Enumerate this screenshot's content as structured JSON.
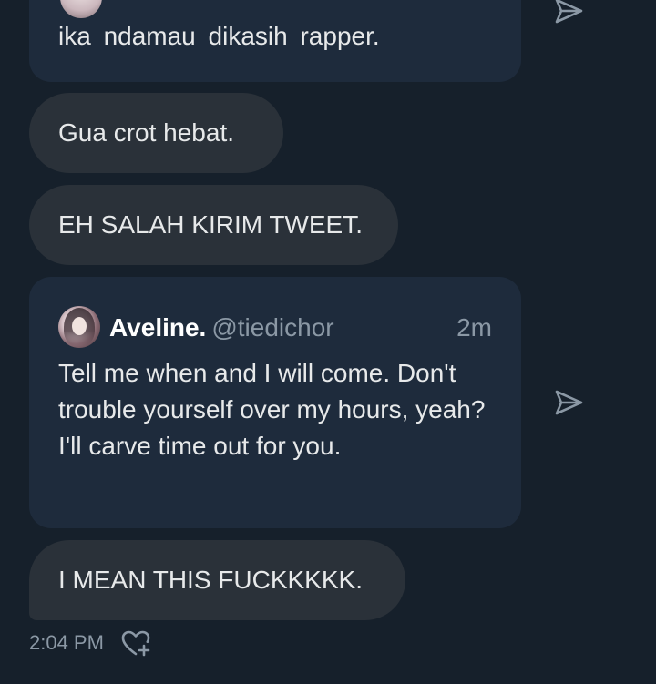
{
  "messages": {
    "quote_top": {
      "text": "ika  ndamau  dikasih  rapper."
    },
    "bubble_1": "Gua crot hebat.",
    "bubble_2": "EH SALAH KIRIM TWEET.",
    "quote_mid": {
      "name": "Aveline.",
      "handle": "@tiedichor",
      "time": "2m",
      "text": "Tell me when and I will come. Don't trouble yourself over my hours, yeah? I'll carve time out for you."
    },
    "bubble_3": "I MEAN THIS FUCKKKKK."
  },
  "footer": {
    "timestamp": "2:04 PM"
  },
  "icons": {
    "share": "share-icon",
    "react": "add-reaction-icon"
  },
  "colors": {
    "background": "#16202b",
    "quote_card": "#1e2b3c",
    "bubble": "#2a3139",
    "muted_text": "#8b98a5"
  }
}
